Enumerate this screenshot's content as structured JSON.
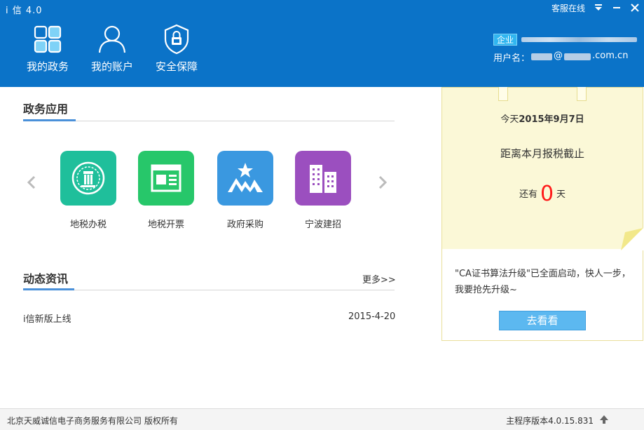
{
  "app": {
    "title": "i 信 4.0"
  },
  "titlebar": {
    "service_status": "客服在线"
  },
  "nav": {
    "items": [
      {
        "label": "我的政务",
        "icon": "grid-icon"
      },
      {
        "label": "我的账户",
        "icon": "user-icon"
      },
      {
        "label": "安全保障",
        "icon": "shield-lock-icon"
      }
    ]
  },
  "user": {
    "badge": "企业",
    "username_label": "用户名：",
    "email_at": "@",
    "email_suffix": ".com.cn"
  },
  "gov_apps": {
    "title": "政务应用",
    "items": [
      {
        "label": "地税办税",
        "color": "#1fbf9b",
        "icon": "tax-emblem-icon"
      },
      {
        "label": "地税开票",
        "color": "#27c76a",
        "icon": "invoice-icon"
      },
      {
        "label": "政府采购",
        "color": "#3a98e0",
        "icon": "star-mountain-icon"
      },
      {
        "label": "宁波建招",
        "color": "#9b4fbf",
        "icon": "buildings-icon"
      }
    ]
  },
  "news": {
    "title": "动态资讯",
    "more": "更多>>",
    "items": [
      {
        "title": "i信新版上线",
        "date": "2015-4-20"
      }
    ]
  },
  "note": {
    "date_prefix": "今天",
    "date": "2015年9月7日",
    "deadline_text": "距离本月报税截止",
    "remaining_prefix": "还有",
    "remaining_days": "0",
    "remaining_suffix": "天",
    "notice": "\"CA证书算法升级\"已全面启动，快人一步，我要抢先升级~",
    "button": "去看看"
  },
  "footer": {
    "copyright": "北京天威诚信电子商务服务有限公司 版权所有",
    "version": "主程序版本4.0.15.831"
  },
  "colors": {
    "header": "#0b73c8",
    "accent": "#4a90d9",
    "note_bg": "#fbf8d7",
    "highlight": "#ff1a1a"
  }
}
